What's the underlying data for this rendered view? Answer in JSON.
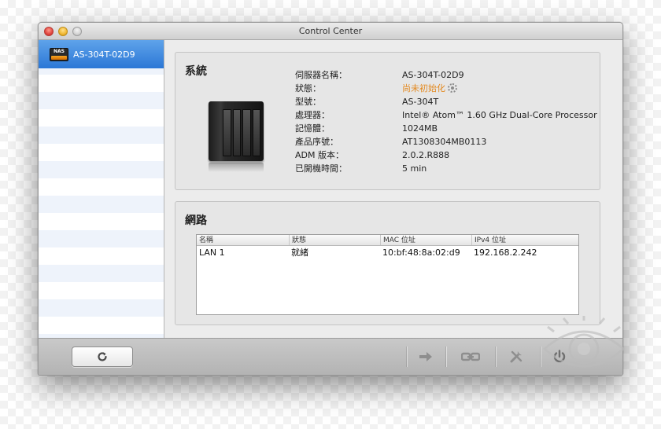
{
  "window": {
    "title": "Control Center"
  },
  "sidebar": {
    "items": [
      {
        "label": "AS-304T-02D9",
        "icon": "nas-icon",
        "badge_text": "NAS",
        "selected": true
      }
    ]
  },
  "system": {
    "title": "系統",
    "rows": [
      {
        "label": "伺服器名稱：",
        "value": "AS-304T-02D9"
      },
      {
        "label": "狀態：",
        "value": "尚未初始化"
      },
      {
        "label": "型號：",
        "value": "AS-304T"
      },
      {
        "label": "處理器：",
        "value": "Intel® Atom™ 1.60 GHz Dual-Core Processor"
      },
      {
        "label": "記憶體：",
        "value": "1024MB"
      },
      {
        "label": "產品序號：",
        "value": "AT1308304MB0113"
      },
      {
        "label": "ADM 版本：",
        "value": "2.0.2.R888"
      },
      {
        "label": "已開機時間：",
        "value": "5 min"
      }
    ],
    "status_color": "#e38a21"
  },
  "network": {
    "title": "網路",
    "columns": [
      "名稱",
      "狀態",
      "MAC 位址",
      "IPv4 位址"
    ],
    "rows": [
      [
        "LAN 1",
        "就緒",
        "10:bf:48:8a:02:d9",
        "192.168.2.242"
      ]
    ]
  },
  "footer": {
    "refresh_icon": "refresh-icon",
    "tools": [
      "arrow-right-icon",
      "link-icon",
      "tools-icon",
      "power-icon"
    ]
  },
  "colors": {
    "selection": "#2b77d6",
    "status_warning": "#e38a21"
  }
}
